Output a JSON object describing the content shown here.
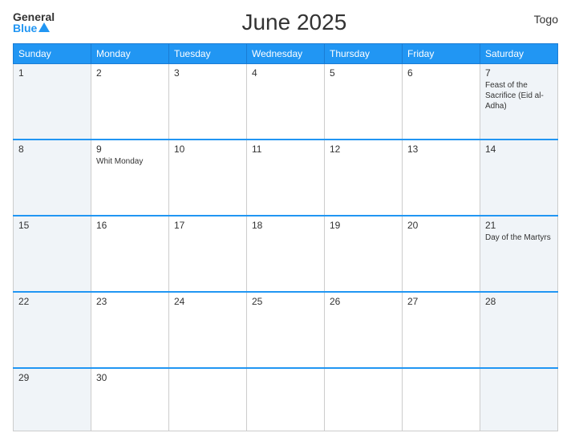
{
  "header": {
    "logo_general": "General",
    "logo_blue": "Blue",
    "title": "June 2025",
    "country": "Togo"
  },
  "columns": [
    "Sunday",
    "Monday",
    "Tuesday",
    "Wednesday",
    "Thursday",
    "Friday",
    "Saturday"
  ],
  "weeks": [
    {
      "days": [
        {
          "date": "1",
          "events": [],
          "col": "sunday"
        },
        {
          "date": "2",
          "events": [],
          "col": "monday"
        },
        {
          "date": "3",
          "events": [],
          "col": "tuesday"
        },
        {
          "date": "4",
          "events": [],
          "col": "wednesday"
        },
        {
          "date": "5",
          "events": [],
          "col": "thursday"
        },
        {
          "date": "6",
          "events": [],
          "col": "friday"
        },
        {
          "date": "7",
          "events": [
            "Feast of the Sacrifice (Eid al-Adha)"
          ],
          "col": "saturday"
        }
      ]
    },
    {
      "days": [
        {
          "date": "8",
          "events": [],
          "col": "sunday"
        },
        {
          "date": "9",
          "events": [
            "Whit Monday"
          ],
          "col": "monday"
        },
        {
          "date": "10",
          "events": [],
          "col": "tuesday"
        },
        {
          "date": "11",
          "events": [],
          "col": "wednesday"
        },
        {
          "date": "12",
          "events": [],
          "col": "thursday"
        },
        {
          "date": "13",
          "events": [],
          "col": "friday"
        },
        {
          "date": "14",
          "events": [],
          "col": "saturday"
        }
      ]
    },
    {
      "days": [
        {
          "date": "15",
          "events": [],
          "col": "sunday"
        },
        {
          "date": "16",
          "events": [],
          "col": "monday"
        },
        {
          "date": "17",
          "events": [],
          "col": "tuesday"
        },
        {
          "date": "18",
          "events": [],
          "col": "wednesday"
        },
        {
          "date": "19",
          "events": [],
          "col": "thursday"
        },
        {
          "date": "20",
          "events": [],
          "col": "friday"
        },
        {
          "date": "21",
          "events": [
            "Day of the Martyrs"
          ],
          "col": "saturday"
        }
      ]
    },
    {
      "days": [
        {
          "date": "22",
          "events": [],
          "col": "sunday"
        },
        {
          "date": "23",
          "events": [],
          "col": "monday"
        },
        {
          "date": "24",
          "events": [],
          "col": "tuesday"
        },
        {
          "date": "25",
          "events": [],
          "col": "wednesday"
        },
        {
          "date": "26",
          "events": [],
          "col": "thursday"
        },
        {
          "date": "27",
          "events": [],
          "col": "friday"
        },
        {
          "date": "28",
          "events": [],
          "col": "saturday"
        }
      ]
    },
    {
      "days": [
        {
          "date": "29",
          "events": [],
          "col": "sunday"
        },
        {
          "date": "30",
          "events": [],
          "col": "monday"
        },
        {
          "date": "",
          "events": [],
          "col": "tuesday"
        },
        {
          "date": "",
          "events": [],
          "col": "wednesday"
        },
        {
          "date": "",
          "events": [],
          "col": "thursday"
        },
        {
          "date": "",
          "events": [],
          "col": "friday"
        },
        {
          "date": "",
          "events": [],
          "col": "saturday"
        }
      ]
    }
  ]
}
